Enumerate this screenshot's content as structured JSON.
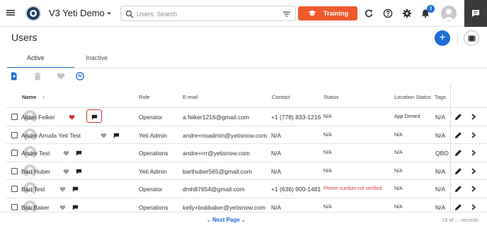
{
  "header": {
    "app_name": "V3 Yeti Demo",
    "search_placeholder": "Users: Search",
    "training_label": "Training",
    "notification_count": "3"
  },
  "page": {
    "title": "Users",
    "add_label": "+"
  },
  "tabs": [
    {
      "label": "Active",
      "active": true
    },
    {
      "label": "Inactive",
      "active": false
    }
  ],
  "table": {
    "columns": {
      "name": "Name",
      "sort_arrow": "↑",
      "role": "Role",
      "email": "E-mail",
      "contact": "Contact",
      "status": "Status",
      "location_status": "Location Status",
      "tags": "Tags"
    },
    "rows": [
      {
        "name": "Aiden Felker",
        "role": "Operator",
        "email": "a.felker1216@gmail.com",
        "contact": "+1 (778) 833-1216",
        "status": "N/A",
        "location_status": "App Denied",
        "tags": "N/A",
        "favorite": true,
        "has_comment_box": true
      },
      {
        "name": "Andre Arruda Yeti Test",
        "role": "Yeti Admin",
        "email": "andre+noadmin@yetisnow.com",
        "contact": "N/A",
        "status": "N/A",
        "location_status": "N/A",
        "tags": "N/A",
        "favorite": false,
        "has_comment_box": false
      },
      {
        "name": "Andre Test",
        "role": "Operations",
        "email": "andre+rrr@yetisnow.com",
        "contact": "N/A",
        "status": "N/A",
        "location_status": "N/A",
        "tags": "QBO",
        "favorite": false,
        "has_comment_box": false
      },
      {
        "name": "Bart Huber",
        "role": "Yeti Admin",
        "email": "barthuber565@gmail.com",
        "contact": "N/A",
        "status": "N/A",
        "location_status": "N/A",
        "tags": "N/A",
        "favorite": false,
        "has_comment_box": false
      },
      {
        "name": "Bart Test",
        "role": "Operator",
        "email": "dmh87654@gmail.com",
        "contact": "+1 (636) 900-1481",
        "status": "Phone number not verified.",
        "location_status": "N/A",
        "tags": "N/A",
        "favorite": false,
        "has_comment_box": false
      },
      {
        "name": "Bob Baker",
        "role": "Operations",
        "email": "kelly+bobbaker@yetisnow.com",
        "contact": "N/A",
        "status": "N/A",
        "location_status": "N/A",
        "tags": "N/A",
        "favorite": false,
        "has_comment_box": false
      }
    ]
  },
  "footer": {
    "next_page": "Next Page",
    "records": "15 of ... records"
  },
  "colors": {
    "accent": "#1f6bd6",
    "training": "#f0592a",
    "favorite": "#d32f2f",
    "warning_text": "#e04040"
  }
}
